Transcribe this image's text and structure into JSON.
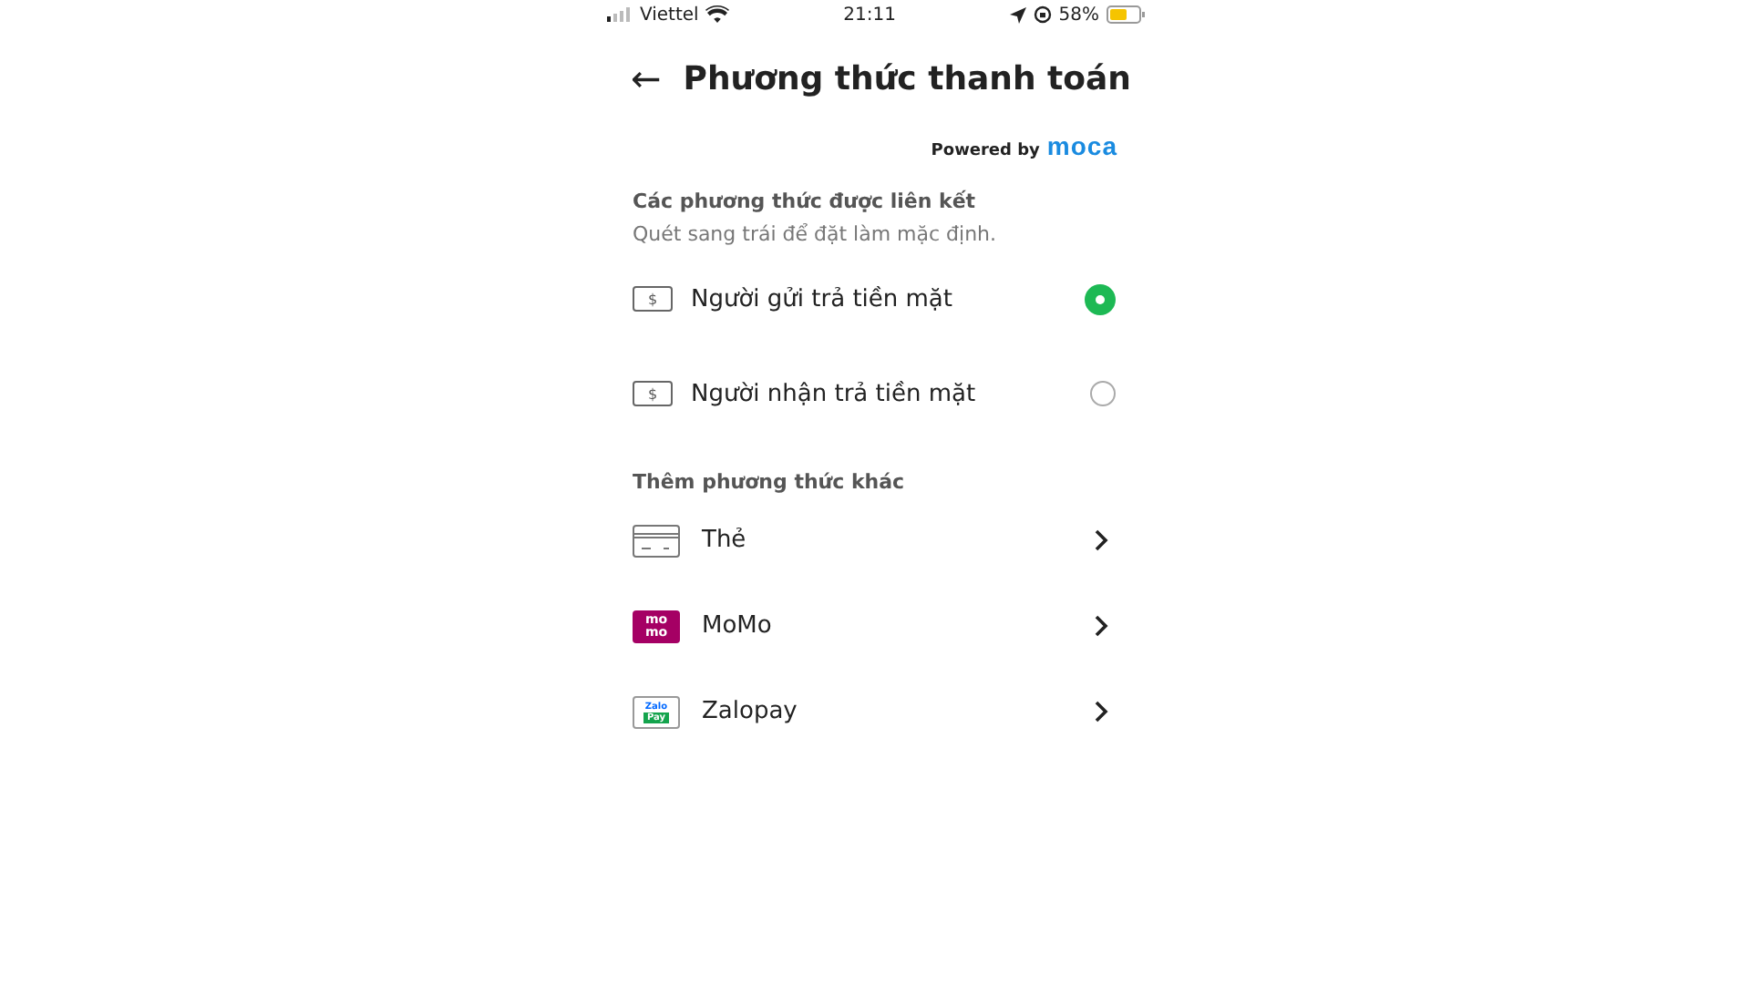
{
  "status_bar": {
    "carrier": "Viettel",
    "time": "21:11",
    "battery": "58%"
  },
  "header": {
    "back_icon": "←",
    "title": "Phương thức thanh toán"
  },
  "powered_by": {
    "label": "Powered by",
    "brand": "moca"
  },
  "linked_section": {
    "title": "Các phương thức được liên kết",
    "hint": "Quét sang trái để đặt làm mặc định.",
    "methods": [
      {
        "kind": "cash",
        "icon_text": [
          "$"
        ],
        "label": "Người gửi trả tiền mặt",
        "selected": true
      },
      {
        "kind": "cash",
        "icon_text": [
          "$"
        ],
        "label": "Người nhận trả tiền mặt",
        "selected": false
      }
    ]
  },
  "other_section": {
    "title": "Thêm phương thức khác",
    "methods": [
      {
        "kind": "card",
        "label": "Thẻ"
      },
      {
        "kind": "momo",
        "icon_text": [
          "mo",
          "mo"
        ],
        "label": "MoMo"
      },
      {
        "kind": "zalopay",
        "icon_text": [
          "Zalo",
          "Pay"
        ],
        "label": "Zalopay"
      }
    ]
  }
}
